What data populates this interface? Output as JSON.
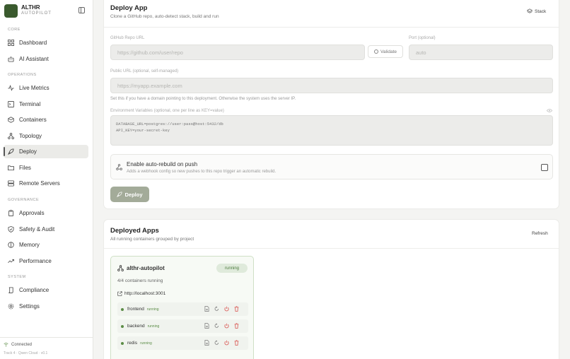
{
  "sidebar": {
    "brand": {
      "name": "ALTHR",
      "subtitle": "AUTOPILOT"
    },
    "sections": {
      "core": "CORE",
      "operations": "OPERATIONS",
      "governance": "GOVERNANCE",
      "system": "SYSTEM"
    },
    "items": [
      {
        "label": "Dashboard",
        "icon": "grid-icon"
      },
      {
        "label": "AI Assistant",
        "icon": "robot-icon"
      },
      {
        "label": "Live Metrics",
        "icon": "activity-icon"
      },
      {
        "label": "Terminal",
        "icon": "terminal-icon"
      },
      {
        "label": "Containers",
        "icon": "box-icon"
      },
      {
        "label": "Topology",
        "icon": "network-icon"
      },
      {
        "label": "Deploy",
        "icon": "rocket-icon",
        "active": true
      },
      {
        "label": "Files",
        "icon": "folder-icon"
      },
      {
        "label": "Remote Servers",
        "icon": "server-icon"
      },
      {
        "label": "Approvals",
        "icon": "clipboard-icon"
      },
      {
        "label": "Safety & Audit",
        "icon": "shield-icon"
      },
      {
        "label": "Memory",
        "icon": "brain-icon"
      },
      {
        "label": "Performance",
        "icon": "trending-up-icon"
      },
      {
        "label": "Compliance",
        "icon": "scroll-icon"
      },
      {
        "label": "Settings",
        "icon": "gear-icon"
      }
    ],
    "footer": {
      "status": "Connected",
      "version": "Track 4 · Qwen Cloud · v0.1"
    }
  },
  "deploy": {
    "title": "Deploy App",
    "subtitle": "Clone a GitHub repo, auto-detect stack, build and run",
    "stack_label": "Stack",
    "repo_label": "GitHub Repo URL",
    "repo_placeholder": "https://github.com/user/repo",
    "validate_label": "Validate",
    "port_label": "Port (optional)",
    "port_placeholder": "auto",
    "public_url_label": "Public URL (optional, self-managed)",
    "public_url_placeholder": "https://myapp.example.com",
    "public_url_hint": "Set this if you have a domain pointing to this deployment. Otherwise the system uses the server IP.",
    "env_label": "Environment Variables (optional, one per line as KEY=value)",
    "env_placeholder": "DATABASE_URL=postgres://user:pass@host:5432/db\nAPI_KEY=your-secret-key",
    "rebuild_title": "Enable auto-rebuild on push",
    "rebuild_desc": "Adds a webhook config so new pushes to this repo trigger an automatic rebuild.",
    "deploy_label": "Deploy"
  },
  "deployed": {
    "title": "Deployed Apps",
    "subtitle": "All running containers grouped by project",
    "refresh_label": "Refresh",
    "app": {
      "name": "althr-autopilot",
      "status": "running",
      "containers": "4/4 containers running",
      "url": "http://localhost:3001",
      "services": [
        {
          "name": "frontend",
          "status": "running"
        },
        {
          "name": "backend",
          "status": "running"
        },
        {
          "name": "redis",
          "status": "running"
        }
      ]
    }
  },
  "colors": {
    "accent": "#3a5a2e",
    "deploy_button": "#a3ab99",
    "running_green": "#5b8c46",
    "danger_red": "#d9534f"
  }
}
